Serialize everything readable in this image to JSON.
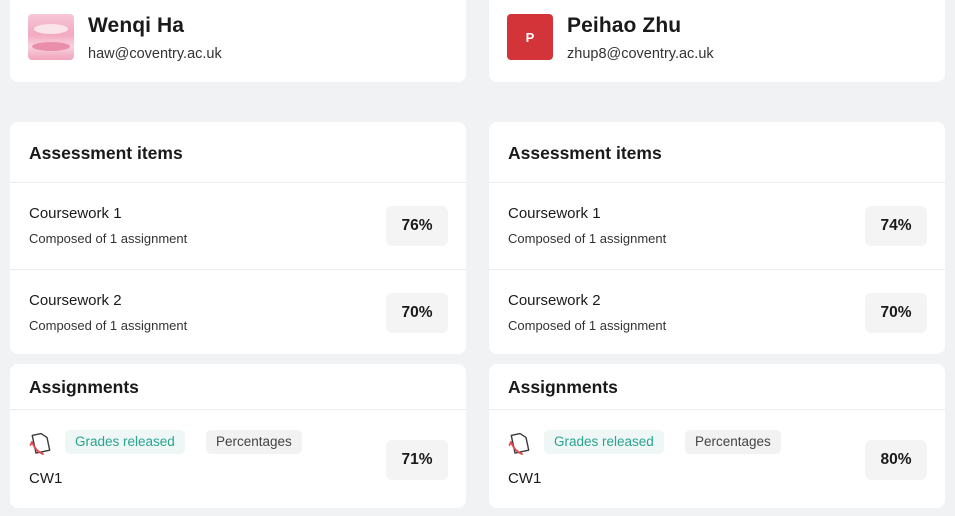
{
  "students": [
    {
      "name": "Wenqi Ha",
      "email": "haw@coventry.ac.uk",
      "avatar_initial": "",
      "assessment_title": "Assessment items",
      "items": [
        {
          "title": "Coursework 1",
          "subtitle": "Composed of 1 assignment",
          "grade": "76%"
        },
        {
          "title": "Coursework 2",
          "subtitle": "Composed of 1 assignment",
          "grade": "70%"
        }
      ],
      "assignments_title": "Assignments",
      "assignment": {
        "status": "Grades released",
        "format": "Percentages",
        "name": "CW1",
        "grade": "71%"
      }
    },
    {
      "name": "Peihao Zhu",
      "email": "zhup8@coventry.ac.uk",
      "avatar_initial": "P",
      "assessment_title": "Assessment items",
      "items": [
        {
          "title": "Coursework 1",
          "subtitle": "Composed of 1 assignment",
          "grade": "74%"
        },
        {
          "title": "Coursework 2",
          "subtitle": "Composed of 1 assignment",
          "grade": "70%"
        }
      ],
      "assignments_title": "Assignments",
      "assignment": {
        "status": "Grades released",
        "format": "Percentages",
        "name": "CW1",
        "grade": "80%"
      }
    }
  ],
  "colors": {
    "status_text": "#2aa38f",
    "status_bg": "#eef7f5",
    "avatar_initial_bg": "#d2343a"
  },
  "icons": {
    "assignment": "document-icon"
  }
}
